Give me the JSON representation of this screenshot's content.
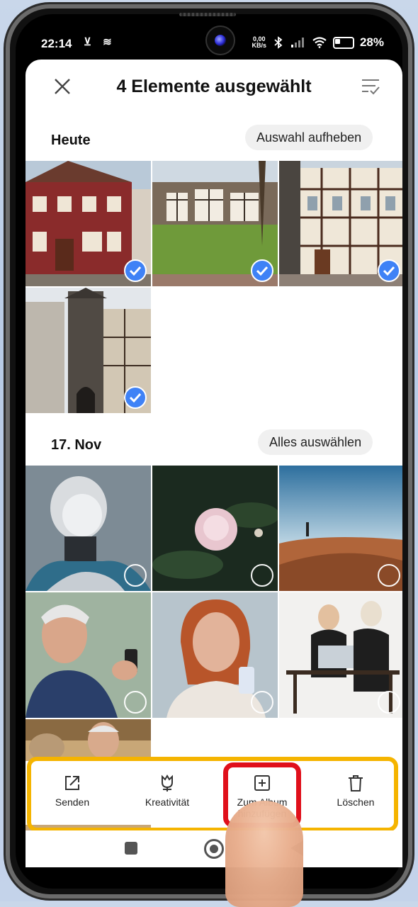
{
  "status_bar": {
    "time": "22:14",
    "left_icons": "⊻ ≋",
    "speed_value": "0,00",
    "speed_unit": "KB/s",
    "battery": "28%"
  },
  "header": {
    "title": "4 Elemente ausgewählt"
  },
  "sections": [
    {
      "label": "Heute",
      "action": "Auswahl aufheben",
      "photos": [
        {
          "selected": true
        },
        {
          "selected": true
        },
        {
          "selected": true
        },
        {
          "selected": true
        }
      ]
    },
    {
      "label": "17. Nov",
      "action": "Alles auswählen",
      "photos": [
        {
          "selected": false
        },
        {
          "selected": false
        },
        {
          "selected": false
        },
        {
          "selected": false
        },
        {
          "selected": false
        },
        {
          "selected": false
        },
        {
          "selected": false
        }
      ]
    }
  ],
  "actions": [
    {
      "label": "Senden",
      "icon": "share-icon"
    },
    {
      "label": "Kreativität",
      "icon": "tulip-icon"
    },
    {
      "label": "Zum Album hinzufügen",
      "icon": "add-box-icon"
    },
    {
      "label": "Löschen",
      "icon": "trash-icon"
    }
  ],
  "colors": {
    "accent": "#3f82f6",
    "highlight_orange": "#f5b400",
    "highlight_red": "#e0101b"
  }
}
